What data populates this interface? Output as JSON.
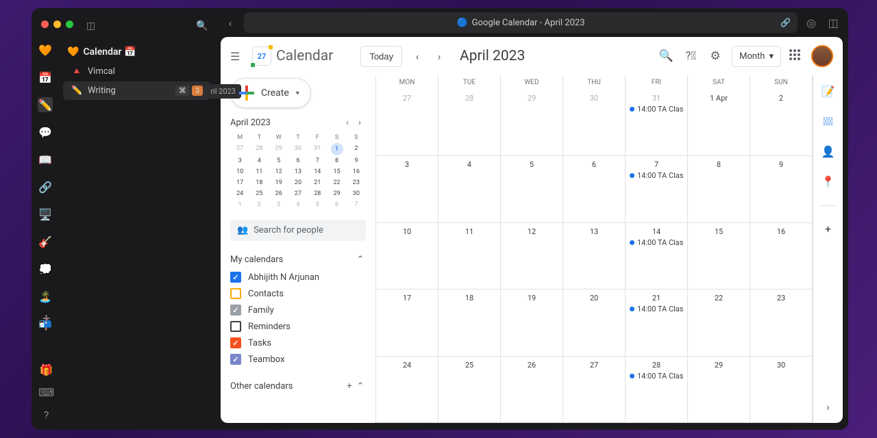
{
  "app_sidebar": {
    "icons": [
      "🧡",
      "📅",
      "✏️",
      "💬",
      "📖",
      "🔗",
      "🖥️",
      "🎸",
      "💭",
      "🏝️",
      "📬"
    ]
  },
  "items": {
    "title_icon": "🧡",
    "title": "Calendar 📅",
    "rows": [
      {
        "emoji": "🔺",
        "label": "Vimcal"
      },
      {
        "emoji": "✏️",
        "label": "Writing",
        "k1": "⌘",
        "k2": "3",
        "breadcrumb": "ril 2023"
      }
    ]
  },
  "browser": {
    "title": "Google Calendar - April 2023"
  },
  "gcal": {
    "logo_num": "27",
    "logo_text": "Calendar",
    "today": "Today",
    "month": "April 2023",
    "view": "Month",
    "create": "Create",
    "mini": {
      "label": "April 2023",
      "dow": [
        "M",
        "T",
        "W",
        "T",
        "F",
        "S",
        "S"
      ],
      "weeks": [
        [
          {
            "d": "27",
            "g": 1
          },
          {
            "d": "28",
            "g": 1
          },
          {
            "d": "29",
            "g": 1
          },
          {
            "d": "30",
            "g": 1
          },
          {
            "d": "31",
            "g": 1
          },
          {
            "d": "1",
            "t": 1
          },
          {
            "d": "2"
          }
        ],
        [
          {
            "d": "3"
          },
          {
            "d": "4"
          },
          {
            "d": "5"
          },
          {
            "d": "6"
          },
          {
            "d": "7"
          },
          {
            "d": "8"
          },
          {
            "d": "9"
          }
        ],
        [
          {
            "d": "10"
          },
          {
            "d": "11"
          },
          {
            "d": "12"
          },
          {
            "d": "13"
          },
          {
            "d": "14"
          },
          {
            "d": "15"
          },
          {
            "d": "16"
          }
        ],
        [
          {
            "d": "17"
          },
          {
            "d": "18"
          },
          {
            "d": "19"
          },
          {
            "d": "20"
          },
          {
            "d": "21"
          },
          {
            "d": "22"
          },
          {
            "d": "23"
          }
        ],
        [
          {
            "d": "24"
          },
          {
            "d": "25"
          },
          {
            "d": "26"
          },
          {
            "d": "27"
          },
          {
            "d": "28"
          },
          {
            "d": "29"
          },
          {
            "d": "30"
          }
        ],
        [
          {
            "d": "1",
            "g": 1
          },
          {
            "d": "2",
            "g": 1
          },
          {
            "d": "3",
            "g": 1
          },
          {
            "d": "4",
            "g": 1
          },
          {
            "d": "5",
            "g": 1
          },
          {
            "d": "6",
            "g": 1
          },
          {
            "d": "7",
            "g": 1
          }
        ]
      ]
    },
    "search_people": "Search for people",
    "my_calendars": "My calendars",
    "other_calendars": "Other calendars",
    "calendars": [
      {
        "name": "Abhijith N Arjunan",
        "color": "#1a73e8",
        "checked": true
      },
      {
        "name": "Contacts",
        "color": "#f9ab00",
        "checked": false
      },
      {
        "name": "Family",
        "color": "#9aa0a6",
        "checked": true
      },
      {
        "name": "Reminders",
        "color": "#3c4043",
        "checked": false
      },
      {
        "name": "Tasks",
        "color": "#f4511e",
        "checked": true
      },
      {
        "name": "Teambox",
        "color": "#7986cb",
        "checked": true
      }
    ],
    "month_header": [
      "MON",
      "TUE",
      "WED",
      "THU",
      "FRI",
      "SAT",
      "SUN"
    ],
    "weeks": [
      [
        {
          "d": "27",
          "g": 1
        },
        {
          "d": "28",
          "g": 1
        },
        {
          "d": "29",
          "g": 1
        },
        {
          "d": "30",
          "g": 1
        },
        {
          "d": "31",
          "g": 1,
          "ev": "14:00 TA Clas"
        },
        {
          "d": "1 Apr"
        },
        {
          "d": "2"
        }
      ],
      [
        {
          "d": "3"
        },
        {
          "d": "4"
        },
        {
          "d": "5"
        },
        {
          "d": "6"
        },
        {
          "d": "7",
          "ev": "14:00 TA Clas"
        },
        {
          "d": "8"
        },
        {
          "d": "9"
        }
      ],
      [
        {
          "d": "10"
        },
        {
          "d": "11"
        },
        {
          "d": "12"
        },
        {
          "d": "13"
        },
        {
          "d": "14",
          "ev": "14:00 TA Clas"
        },
        {
          "d": "15"
        },
        {
          "d": "16"
        }
      ],
      [
        {
          "d": "17"
        },
        {
          "d": "18"
        },
        {
          "d": "19"
        },
        {
          "d": "20"
        },
        {
          "d": "21",
          "ev": "14:00 TA Clas"
        },
        {
          "d": "22"
        },
        {
          "d": "23"
        }
      ],
      [
        {
          "d": "24"
        },
        {
          "d": "25"
        },
        {
          "d": "26"
        },
        {
          "d": "27"
        },
        {
          "d": "28",
          "ev": "14:00 TA Clas"
        },
        {
          "d": "29"
        },
        {
          "d": "30"
        }
      ]
    ]
  }
}
